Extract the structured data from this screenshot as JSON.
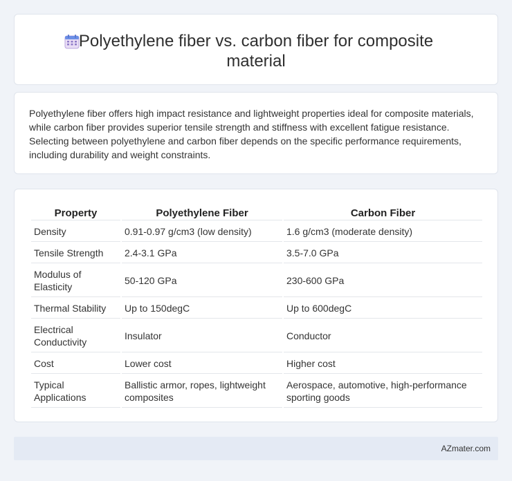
{
  "header": {
    "title": "Polyethylene fiber vs. carbon fiber for composite material",
    "icon": "calendar-icon"
  },
  "summary": {
    "text": "Polyethylene fiber offers high impact resistance and lightweight properties ideal for composite materials, while carbon fiber provides superior tensile strength and stiffness with excellent fatigue resistance. Selecting between polyethylene and carbon fiber depends on the specific performance requirements, including durability and weight constraints."
  },
  "table": {
    "headers": [
      "Property",
      "Polyethylene Fiber",
      "Carbon Fiber"
    ],
    "rows": [
      [
        "Density",
        "0.91-0.97 g/cm3 (low density)",
        "1.6 g/cm3 (moderate density)"
      ],
      [
        "Tensile Strength",
        "2.4-3.1 GPa",
        "3.5-7.0 GPa"
      ],
      [
        "Modulus of Elasticity",
        "50-120 GPa",
        "230-600 GPa"
      ],
      [
        "Thermal Stability",
        "Up to 150degC",
        "Up to 600degC"
      ],
      [
        "Electrical Conductivity",
        "Insulator",
        "Conductor"
      ],
      [
        "Cost",
        "Lower cost",
        "Higher cost"
      ],
      [
        "Typical Applications",
        "Ballistic armor, ropes, lightweight composites",
        "Aerospace, automotive, high-performance sporting goods"
      ]
    ]
  },
  "footer": {
    "site": "AZmater.com"
  }
}
